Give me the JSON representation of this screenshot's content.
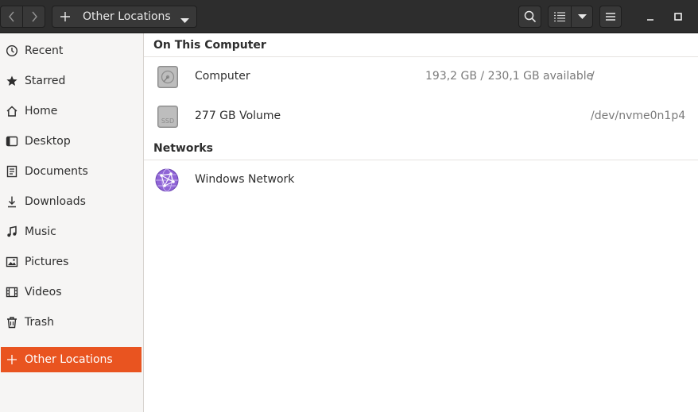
{
  "header": {
    "path_label": "Other Locations"
  },
  "sidebar": {
    "items": [
      {
        "label": "Recent",
        "icon": "clock-icon"
      },
      {
        "label": "Starred",
        "icon": "star-icon"
      },
      {
        "label": "Home",
        "icon": "home-icon"
      },
      {
        "label": "Desktop",
        "icon": "desktop-icon"
      },
      {
        "label": "Documents",
        "icon": "document-icon"
      },
      {
        "label": "Downloads",
        "icon": "download-icon"
      },
      {
        "label": "Music",
        "icon": "music-icon"
      },
      {
        "label": "Pictures",
        "icon": "picture-icon"
      },
      {
        "label": "Videos",
        "icon": "video-icon"
      },
      {
        "label": "Trash",
        "icon": "trash-icon"
      }
    ],
    "active_item": {
      "label": "Other Locations",
      "icon": "plus-icon"
    }
  },
  "main": {
    "on_this_computer": {
      "title": "On This Computer",
      "rows": [
        {
          "name": "Computer",
          "size": "193,2 GB / 230,1 GB available",
          "path": "/",
          "icon": "hard-disk-icon"
        },
        {
          "name": "277 GB Volume",
          "size": "",
          "path": "/dev/nvme0n1p4",
          "icon": "ssd-icon",
          "icon_text": "SSD"
        }
      ]
    },
    "networks": {
      "title": "Networks",
      "rows": [
        {
          "name": "Windows Network",
          "icon": "network-globe-icon"
        }
      ]
    }
  },
  "colors": {
    "accent": "#e95420",
    "headerbar": "#2d2d2d",
    "sidebar_bg": "#f6f5f4",
    "network_icon": "#8f64d6"
  }
}
